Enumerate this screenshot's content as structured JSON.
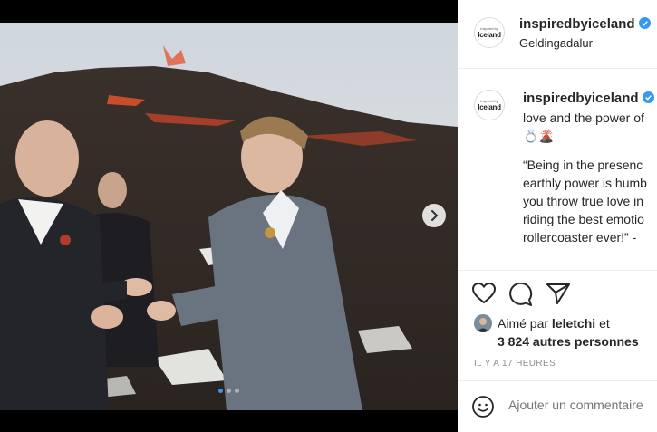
{
  "post": {
    "author": "inspiredbyiceland",
    "avatar_small_text": "Inspired by",
    "avatar_logo_text": "Iceland",
    "location": "Geldingadalur",
    "caption_lines": [
      "love and the power of",
      "💍🌋",
      "",
      "“Being in the presenc",
      "earthly power is humb",
      "you throw true love in",
      "riding the best emotio",
      "rollercoaster ever!” - "
    ],
    "liked_by_prefix": "Aimé par",
    "liked_by_user": "leletchi",
    "liked_by_suffix": "et",
    "likes_count_text": "3 824 autres personnes",
    "timestamp": "IL Y A 17 HEURES",
    "comment_placeholder": "Ajouter un commentaire"
  },
  "carousel": {
    "slides": 3,
    "active_index": 0
  },
  "icons": {
    "next": "chevron-right-icon",
    "verified": "verified-badge-icon",
    "like": "heart-icon",
    "comment": "comment-bubble-icon",
    "share": "paper-plane-icon",
    "emoji": "emoji-icon"
  },
  "colors": {
    "verified": "#3897f0",
    "active_dot": "#3897f0",
    "text": "#262626",
    "muted": "#8e8e8e"
  }
}
